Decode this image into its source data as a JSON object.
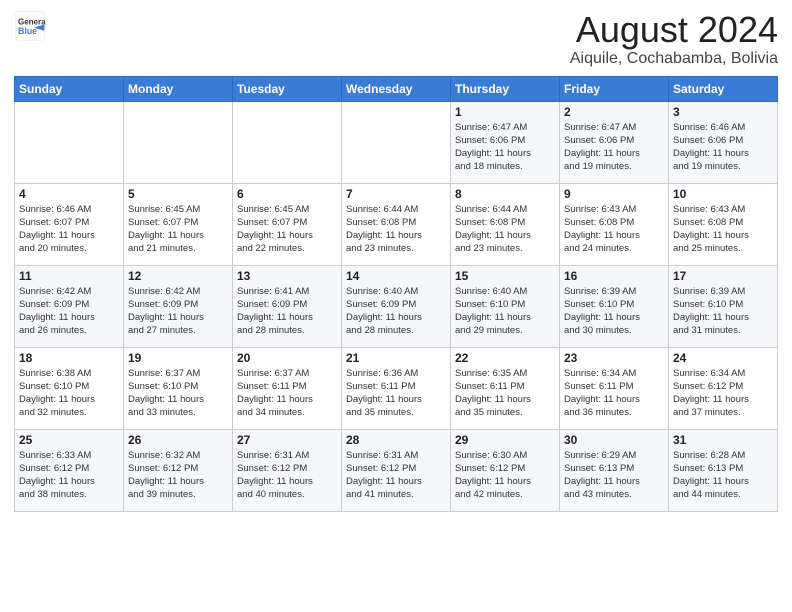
{
  "logo": {
    "text_general": "General",
    "text_blue": "Blue"
  },
  "title": "August 2024",
  "subtitle": "Aiquile, Cochabamba, Bolivia",
  "weekdays": [
    "Sunday",
    "Monday",
    "Tuesday",
    "Wednesday",
    "Thursday",
    "Friday",
    "Saturday"
  ],
  "weeks": [
    [
      {
        "day": "",
        "info": ""
      },
      {
        "day": "",
        "info": ""
      },
      {
        "day": "",
        "info": ""
      },
      {
        "day": "",
        "info": ""
      },
      {
        "day": "1",
        "info": "Sunrise: 6:47 AM\nSunset: 6:06 PM\nDaylight: 11 hours\nand 18 minutes."
      },
      {
        "day": "2",
        "info": "Sunrise: 6:47 AM\nSunset: 6:06 PM\nDaylight: 11 hours\nand 19 minutes."
      },
      {
        "day": "3",
        "info": "Sunrise: 6:46 AM\nSunset: 6:06 PM\nDaylight: 11 hours\nand 19 minutes."
      }
    ],
    [
      {
        "day": "4",
        "info": "Sunrise: 6:46 AM\nSunset: 6:07 PM\nDaylight: 11 hours\nand 20 minutes."
      },
      {
        "day": "5",
        "info": "Sunrise: 6:45 AM\nSunset: 6:07 PM\nDaylight: 11 hours\nand 21 minutes."
      },
      {
        "day": "6",
        "info": "Sunrise: 6:45 AM\nSunset: 6:07 PM\nDaylight: 11 hours\nand 22 minutes."
      },
      {
        "day": "7",
        "info": "Sunrise: 6:44 AM\nSunset: 6:08 PM\nDaylight: 11 hours\nand 23 minutes."
      },
      {
        "day": "8",
        "info": "Sunrise: 6:44 AM\nSunset: 6:08 PM\nDaylight: 11 hours\nand 23 minutes."
      },
      {
        "day": "9",
        "info": "Sunrise: 6:43 AM\nSunset: 6:08 PM\nDaylight: 11 hours\nand 24 minutes."
      },
      {
        "day": "10",
        "info": "Sunrise: 6:43 AM\nSunset: 6:08 PM\nDaylight: 11 hours\nand 25 minutes."
      }
    ],
    [
      {
        "day": "11",
        "info": "Sunrise: 6:42 AM\nSunset: 6:09 PM\nDaylight: 11 hours\nand 26 minutes."
      },
      {
        "day": "12",
        "info": "Sunrise: 6:42 AM\nSunset: 6:09 PM\nDaylight: 11 hours\nand 27 minutes."
      },
      {
        "day": "13",
        "info": "Sunrise: 6:41 AM\nSunset: 6:09 PM\nDaylight: 11 hours\nand 28 minutes."
      },
      {
        "day": "14",
        "info": "Sunrise: 6:40 AM\nSunset: 6:09 PM\nDaylight: 11 hours\nand 28 minutes."
      },
      {
        "day": "15",
        "info": "Sunrise: 6:40 AM\nSunset: 6:10 PM\nDaylight: 11 hours\nand 29 minutes."
      },
      {
        "day": "16",
        "info": "Sunrise: 6:39 AM\nSunset: 6:10 PM\nDaylight: 11 hours\nand 30 minutes."
      },
      {
        "day": "17",
        "info": "Sunrise: 6:39 AM\nSunset: 6:10 PM\nDaylight: 11 hours\nand 31 minutes."
      }
    ],
    [
      {
        "day": "18",
        "info": "Sunrise: 6:38 AM\nSunset: 6:10 PM\nDaylight: 11 hours\nand 32 minutes."
      },
      {
        "day": "19",
        "info": "Sunrise: 6:37 AM\nSunset: 6:10 PM\nDaylight: 11 hours\nand 33 minutes."
      },
      {
        "day": "20",
        "info": "Sunrise: 6:37 AM\nSunset: 6:11 PM\nDaylight: 11 hours\nand 34 minutes."
      },
      {
        "day": "21",
        "info": "Sunrise: 6:36 AM\nSunset: 6:11 PM\nDaylight: 11 hours\nand 35 minutes."
      },
      {
        "day": "22",
        "info": "Sunrise: 6:35 AM\nSunset: 6:11 PM\nDaylight: 11 hours\nand 35 minutes."
      },
      {
        "day": "23",
        "info": "Sunrise: 6:34 AM\nSunset: 6:11 PM\nDaylight: 11 hours\nand 36 minutes."
      },
      {
        "day": "24",
        "info": "Sunrise: 6:34 AM\nSunset: 6:12 PM\nDaylight: 11 hours\nand 37 minutes."
      }
    ],
    [
      {
        "day": "25",
        "info": "Sunrise: 6:33 AM\nSunset: 6:12 PM\nDaylight: 11 hours\nand 38 minutes."
      },
      {
        "day": "26",
        "info": "Sunrise: 6:32 AM\nSunset: 6:12 PM\nDaylight: 11 hours\nand 39 minutes."
      },
      {
        "day": "27",
        "info": "Sunrise: 6:31 AM\nSunset: 6:12 PM\nDaylight: 11 hours\nand 40 minutes."
      },
      {
        "day": "28",
        "info": "Sunrise: 6:31 AM\nSunset: 6:12 PM\nDaylight: 11 hours\nand 41 minutes."
      },
      {
        "day": "29",
        "info": "Sunrise: 6:30 AM\nSunset: 6:12 PM\nDaylight: 11 hours\nand 42 minutes."
      },
      {
        "day": "30",
        "info": "Sunrise: 6:29 AM\nSunset: 6:13 PM\nDaylight: 11 hours\nand 43 minutes."
      },
      {
        "day": "31",
        "info": "Sunrise: 6:28 AM\nSunset: 6:13 PM\nDaylight: 11 hours\nand 44 minutes."
      }
    ]
  ]
}
